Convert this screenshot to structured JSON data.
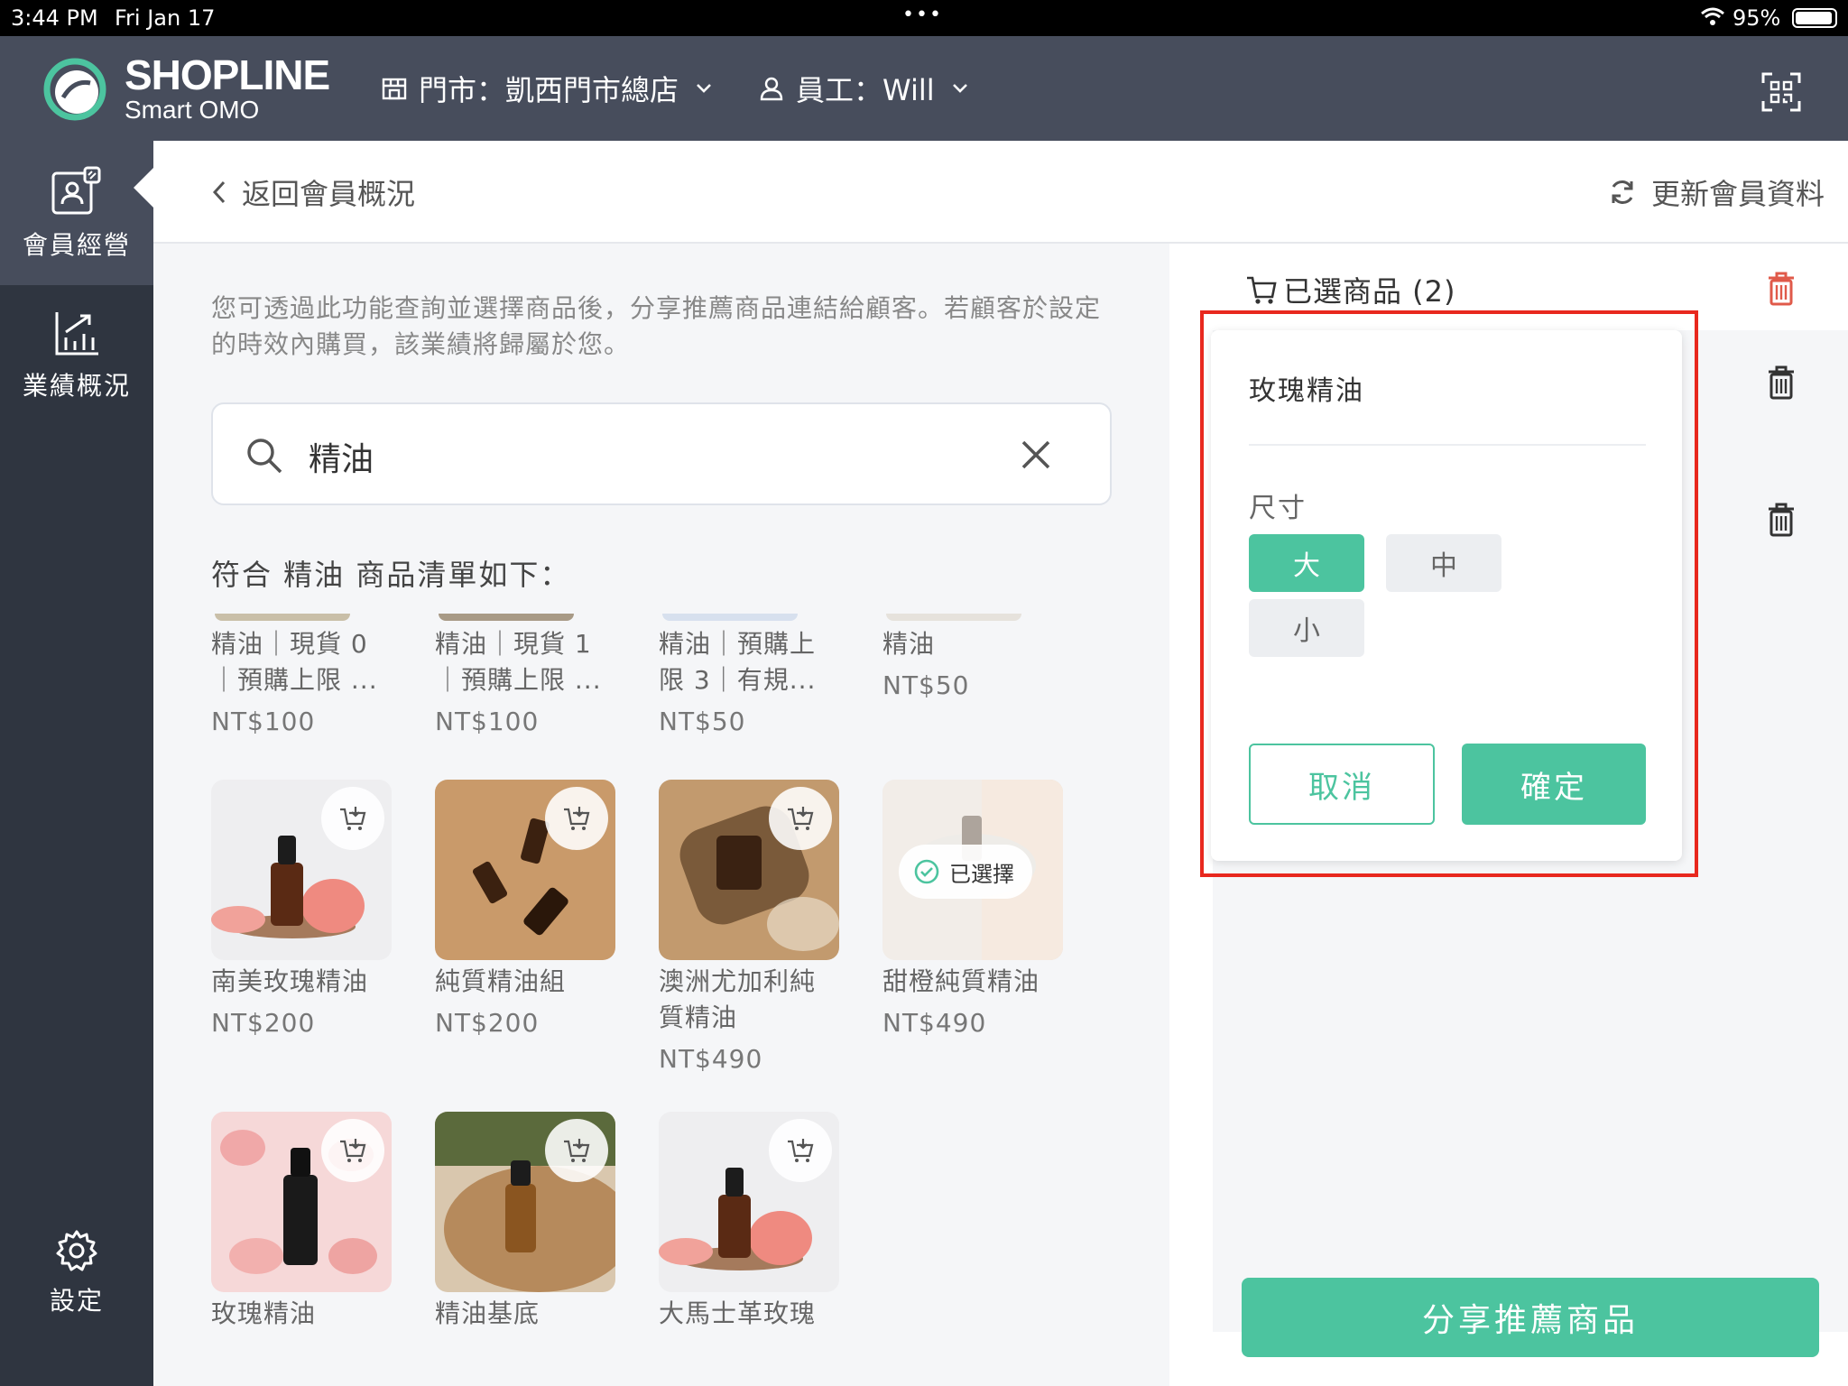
{
  "status_bar": {
    "time": "3:44 PM",
    "date": "Fri Jan 17",
    "battery": "95%"
  },
  "header": {
    "brand": "SHOPLINE",
    "brand_sub": "Smart OMO",
    "store_label": "門市：凱西門市總店",
    "staff_label": "員工：Will"
  },
  "sidebar": {
    "items": [
      {
        "label": "會員經營",
        "icon": "member-card-icon",
        "active": true
      },
      {
        "label": "業績概況",
        "icon": "chart-icon",
        "active": false
      },
      {
        "label": "設定",
        "icon": "gear-icon",
        "active": false
      }
    ]
  },
  "subheader": {
    "back_label": "返回會員概況",
    "refresh_label": "更新會員資料"
  },
  "main": {
    "description": "您可透過此功能查詢並選擇商品後，分享推薦商品連結給顧客。若顧客於設定的時效內購買，該業績將歸屬於您。",
    "search_value": "精油",
    "result_title": "符合 精油 商品清單如下："
  },
  "products": [
    {
      "name": "精油｜現貨 0｜預購上限 ...",
      "price": "NT$100"
    },
    {
      "name": "精油｜現貨 1｜預購上限 ...",
      "price": "NT$100"
    },
    {
      "name": "精油｜預購上限 3｜有規...",
      "price": "NT$50"
    },
    {
      "name": "精油",
      "price": "NT$50"
    },
    {
      "name": "南美玫瑰精油",
      "price": "NT$200"
    },
    {
      "name": "純質精油組",
      "price": "NT$200"
    },
    {
      "name": "澳洲尤加利純質精油",
      "price": "NT$490"
    },
    {
      "name": "甜橙純質精油",
      "price": "NT$490",
      "selected_label": "已選擇"
    },
    {
      "name": "玫瑰精油",
      "price": ""
    },
    {
      "name": "精油基底",
      "price": ""
    },
    {
      "name": "大馬士革玫瑰",
      "price": ""
    }
  ],
  "cart": {
    "title": "已選商品 (2)"
  },
  "popup": {
    "product_name": "玫瑰精油",
    "option_label": "尺寸",
    "options": [
      "大",
      "中",
      "小"
    ],
    "selected_option": "大",
    "cancel_label": "取消",
    "confirm_label": "確定"
  },
  "share_label": "分享推薦商品",
  "colors": {
    "accent": "#4cc49f",
    "header_bg": "#474d5c",
    "sidebar_bg": "#2f3540",
    "highlight": "#e8281e",
    "danger": "#e05a4a"
  }
}
